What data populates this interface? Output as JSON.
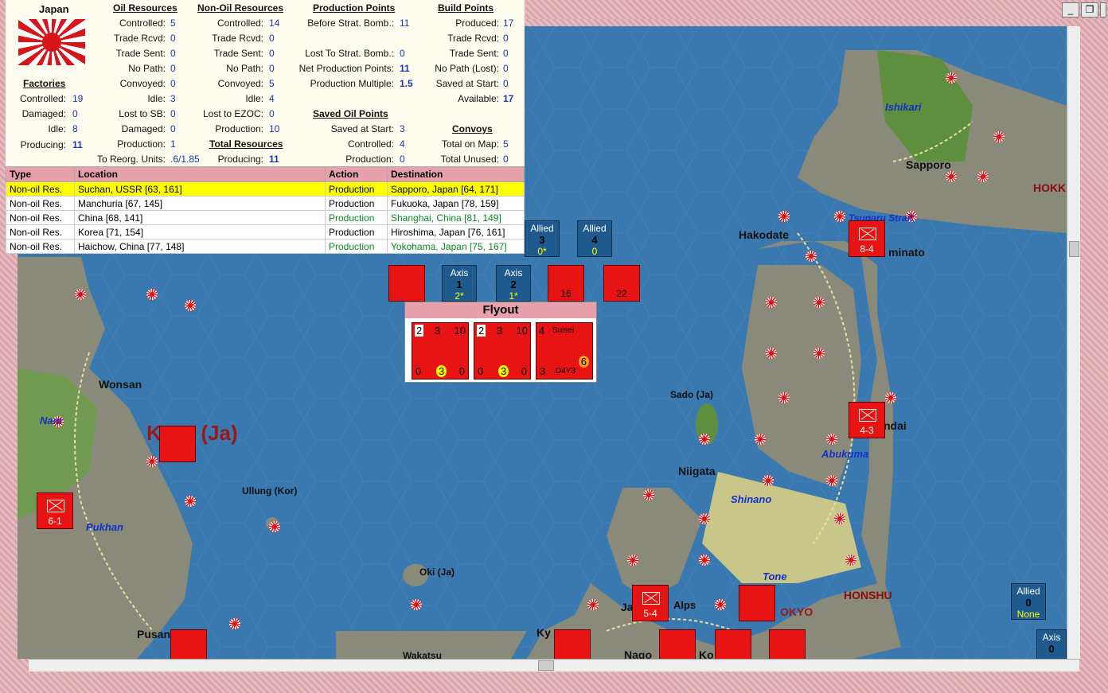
{
  "window": {
    "minimize_icon": "minimize-icon",
    "restore_icon": "restore-icon",
    "close_icon": "close-icon"
  },
  "panel": {
    "country": "Japan",
    "factories": {
      "title": "Factories",
      "rows": [
        {
          "label": "Controlled:",
          "value": "19"
        },
        {
          "label": "Damaged:",
          "value": "0"
        },
        {
          "label": "Idle:",
          "value": "8"
        },
        {
          "label": "Producing:",
          "value": "11"
        }
      ]
    },
    "oil": {
      "title": "Oil Resources",
      "rows": [
        {
          "label": "Controlled:",
          "value": "5"
        },
        {
          "label": "Trade Rcvd:",
          "value": "0"
        },
        {
          "label": "Trade Sent:",
          "value": "0"
        },
        {
          "label": "No Path:",
          "value": "0"
        },
        {
          "label": "Convoyed:",
          "value": "0"
        },
        {
          "label": "Idle:",
          "value": "3"
        },
        {
          "label": "Lost to SB:",
          "value": "0"
        },
        {
          "label": "Damaged:",
          "value": "0"
        },
        {
          "label": "Production:",
          "value": "1"
        }
      ]
    },
    "reorg": {
      "label": "To Reorg. Units:",
      "value": ".6/1.85"
    },
    "nonoil": {
      "title": "Non-Oil Resources",
      "rows": [
        {
          "label": "Controlled:",
          "value": "14"
        },
        {
          "label": "Trade Rcvd:",
          "value": "0"
        },
        {
          "label": "Trade Sent:",
          "value": "0"
        },
        {
          "label": "No Path:",
          "value": "0"
        },
        {
          "label": "Convoyed:",
          "value": "5"
        },
        {
          "label": "Idle:",
          "value": "4"
        },
        {
          "label": "Lost to EZOC:",
          "value": "0"
        },
        {
          "label": "Production:",
          "value": "10"
        }
      ]
    },
    "total": {
      "title": "Total Resources",
      "rows": [
        {
          "label": "Producing:",
          "value": "11"
        }
      ]
    },
    "production_points": {
      "title": "Production Points",
      "rows": [
        {
          "label": "Before Strat. Bomb.:",
          "value": "11"
        },
        {
          "label": "Lost To Strat. Bomb.:",
          "value": "0"
        },
        {
          "label": "Net Production Points:",
          "value": "11"
        },
        {
          "label": "Production Multiple:",
          "value": "1.5"
        }
      ]
    },
    "saved_oil": {
      "title": "Saved Oil Points",
      "rows": [
        {
          "label": "Saved at Start:",
          "value": "3"
        },
        {
          "label": "Controlled:",
          "value": "4"
        },
        {
          "label": "Production:",
          "value": "0"
        }
      ]
    },
    "build_points": {
      "title": "Build Points",
      "rows": [
        {
          "label": "Produced:",
          "value": "17"
        },
        {
          "label": "Trade Rcvd:",
          "value": "0"
        },
        {
          "label": "Trade Sent:",
          "value": "0"
        },
        {
          "label": "No Path (Lost):",
          "value": "0"
        },
        {
          "label": "Saved at Start:",
          "value": "0"
        },
        {
          "label": "Available:",
          "value": "17"
        }
      ]
    },
    "convoys": {
      "title": "Convoys",
      "rows": [
        {
          "label": "Total on Map:",
          "value": "5"
        },
        {
          "label": "Total Unused:",
          "value": "0"
        }
      ]
    }
  },
  "table": {
    "headers": [
      "Type",
      "Location",
      "Action",
      "Destination"
    ],
    "rows": [
      [
        "Non-oil Res.",
        "Suchan, USSR [63, 161]",
        "Production",
        "Sapporo, Japan [64, 171]"
      ],
      [
        "Non-oil Res.",
        "Manchuria [67, 145]",
        "Production",
        "Fukuoka, Japan [78, 159]"
      ],
      [
        "Non-oil Res.",
        "China [68, 141]",
        "Production",
        "Shanghai, China [81, 149]"
      ],
      [
        "Non-oil Res.",
        "Korea [71, 154]",
        "Production",
        "Hiroshima, Japan [76, 161]"
      ],
      [
        "Non-oil Res.",
        "Haichow, China [77, 148]",
        "Production",
        "Yokohama, Japan [75, 167]"
      ]
    ]
  },
  "flyout": {
    "title": "Flyout",
    "cards": [
      {
        "tl": "2",
        "tm": "3",
        "tr": "10",
        "bl": "0",
        "bm": "3",
        "br": "0"
      },
      {
        "tl": "2",
        "tm": "3",
        "tr": "10",
        "bl": "0",
        "bm": "3",
        "br": "0"
      },
      {
        "tl": "4",
        "tm": "Suisei",
        "tr": "",
        "bl": "3",
        "bm": "D4Y3",
        "br": "6"
      }
    ]
  },
  "counters": [
    {
      "side": "Allied",
      "value": "3",
      "sub": "0*"
    },
    {
      "side": "Allied",
      "value": "4",
      "sub": "0"
    },
    {
      "side": "Axis",
      "value": "1",
      "sub": "2*"
    },
    {
      "side": "Axis",
      "value": "2",
      "sub": "1*"
    },
    {
      "side": "Allied",
      "value": "0",
      "sub": "None"
    },
    {
      "side": "Axis",
      "value": "0",
      "sub": ""
    }
  ],
  "map_labels": {
    "places": [
      "Hakodate",
      "Sapporo",
      "Wonsan",
      "Niigata",
      "Sado (Ja)",
      "Ullung (Kor)",
      "Oki (Ja)",
      "Pusan",
      "Wakatsu",
      "Alps",
      "Nago",
      "Ja",
      "Ky",
      "Ko",
      "minato",
      "ndai",
      "OKYO"
    ],
    "rivers": [
      "Ishikari",
      "Tsugaru Strait",
      "Nam",
      "Pukhan",
      "Shinano",
      "Abukuma",
      "Tone"
    ],
    "regions": [
      "HOKK",
      "HONSHU"
    ],
    "big_region": "K    EA (Ja)",
    "unit_values": [
      "8-4",
      "4-3",
      "6-1",
      "5-4",
      "16",
      "22"
    ]
  }
}
